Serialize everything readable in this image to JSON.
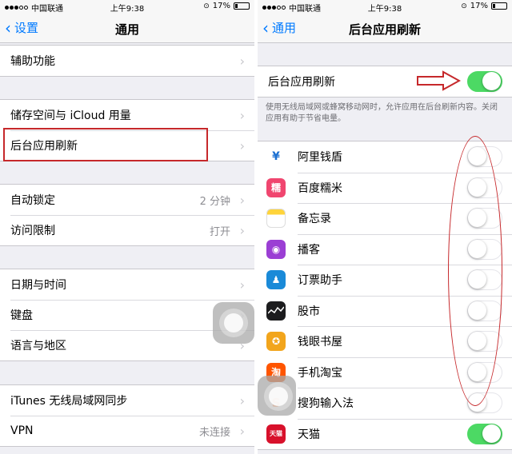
{
  "status_bar": {
    "carrier": "中国联通",
    "time": "上午9:38",
    "battery": "17%",
    "battery_level": 0.17
  },
  "left": {
    "nav": {
      "back_label": "设置",
      "title": "通用"
    },
    "groups": [
      [
        {
          "label": "辅助功能",
          "value": ""
        }
      ],
      [
        {
          "label": "储存空间与 iCloud 用量",
          "value": ""
        },
        {
          "label": "后台应用刷新",
          "value": ""
        }
      ],
      [
        {
          "label": "自动锁定",
          "value": "2 分钟"
        },
        {
          "label": "访问限制",
          "value": "打开"
        }
      ],
      [
        {
          "label": "日期与时间",
          "value": ""
        },
        {
          "label": "键盘",
          "value": ""
        },
        {
          "label": "语言与地区",
          "value": ""
        }
      ],
      [
        {
          "label": "iTunes 无线局域网同步",
          "value": ""
        },
        {
          "label": "VPN",
          "value": "未连接"
        }
      ]
    ]
  },
  "right": {
    "nav": {
      "back_label": "通用",
      "title": "后台应用刷新"
    },
    "master": {
      "label": "后台应用刷新",
      "on": true
    },
    "description": "使用无线局域网或蜂窝移动网时，允许应用在后台刷新内容。关闭应用有助于节省电量。",
    "apps": [
      {
        "name": "阿里钱盾",
        "icon": "alipay-shield-icon",
        "color": "#ffffff",
        "glyph": "¥",
        "on": false
      },
      {
        "name": "百度糯米",
        "icon": "baidu-nuomi-icon",
        "color": "#f0466f",
        "glyph": "糯",
        "on": false
      },
      {
        "name": "备忘录",
        "icon": "notes-icon",
        "color": "#ffd43a",
        "glyph": "",
        "on": false
      },
      {
        "name": "播客",
        "icon": "podcasts-icon",
        "color": "#9b3fd4",
        "glyph": "◉",
        "on": false
      },
      {
        "name": "订票助手",
        "icon": "ticket-assistant-icon",
        "color": "#1a8ad8",
        "glyph": "♟",
        "on": false
      },
      {
        "name": "股市",
        "icon": "stocks-icon",
        "color": "#1c1c1e",
        "glyph": "",
        "on": false
      },
      {
        "name": "钱眼书屋",
        "icon": "book-store-icon",
        "color": "#f2a51c",
        "glyph": "✪",
        "on": false
      },
      {
        "name": "手机淘宝",
        "icon": "taobao-icon",
        "color": "#ff5500",
        "glyph": "淘",
        "on": false
      },
      {
        "name": "搜狗输入法",
        "icon": "sogou-input-icon",
        "color": "#ffffff",
        "glyph": "S",
        "on": false
      },
      {
        "name": "天猫",
        "icon": "tmall-icon",
        "color": "#d8112b",
        "glyph": "天猫",
        "on": true
      }
    ]
  },
  "colors": {
    "ios_blue": "#007aff",
    "toggle_on": "#4cd964",
    "annotation_red": "#c6282b"
  }
}
